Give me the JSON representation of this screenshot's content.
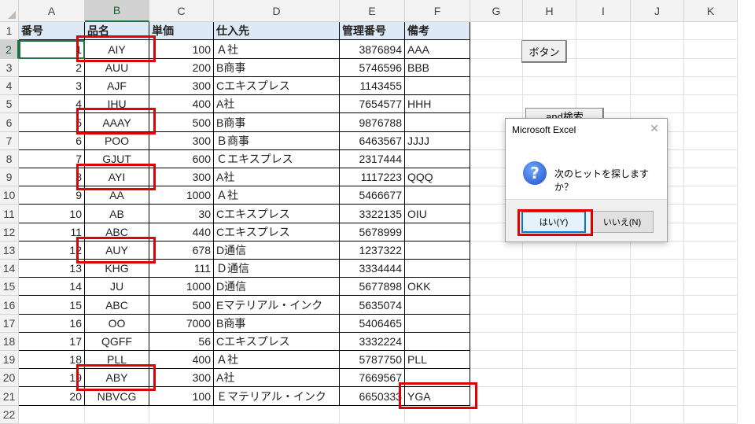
{
  "columns": [
    "A",
    "B",
    "C",
    "D",
    "E",
    "F",
    "G",
    "H",
    "I",
    "J",
    "K"
  ],
  "selected_column": "B",
  "rows": [
    "1",
    "2",
    "3",
    "4",
    "5",
    "6",
    "7",
    "8",
    "9",
    "10",
    "11",
    "12",
    "13",
    "14",
    "15",
    "16",
    "17",
    "18",
    "19",
    "20",
    "21",
    "22"
  ],
  "selected_row": "2",
  "table": {
    "headers": [
      "番号",
      "品名",
      "単価",
      "仕入先",
      "管理番号",
      "備考"
    ],
    "records": [
      [
        "1",
        "AIY",
        "100",
        "Ａ社",
        "3876894",
        "AAA"
      ],
      [
        "2",
        "AUU",
        "200",
        "B商事",
        "5746596",
        "BBB"
      ],
      [
        "3",
        "AJF",
        "300",
        "Cエキスプレス",
        "1143455",
        ""
      ],
      [
        "4",
        "IHU",
        "400",
        "A社",
        "7654577",
        "HHH"
      ],
      [
        "5",
        "AAAY",
        "500",
        "B商事",
        "9876788",
        ""
      ],
      [
        "6",
        "POO",
        "300",
        "Ｂ商事",
        "6463567",
        "JJJJ"
      ],
      [
        "7",
        "GJUT",
        "600",
        "Ｃエキスプレス",
        "2317444",
        ""
      ],
      [
        "8",
        "AYI",
        "300",
        "A社",
        "1117223",
        "QQQ"
      ],
      [
        "9",
        "AA",
        "1000",
        "Ａ社",
        "5466677",
        ""
      ],
      [
        "10",
        "AB",
        "30",
        "Cエキスプレス",
        "3322135",
        "OIU"
      ],
      [
        "11",
        "ABC",
        "440",
        "Cエキスプレス",
        "5678999",
        ""
      ],
      [
        "12",
        "AUY",
        "678",
        "D通信",
        "1237322",
        ""
      ],
      [
        "13",
        "KHG",
        "111",
        "Ｄ通信",
        "3334444",
        ""
      ],
      [
        "14",
        "JU",
        "1000",
        "D通信",
        "5677898",
        "OKK"
      ],
      [
        "15",
        "ABC",
        "500",
        "Eマテリアル・インク",
        "5635074",
        ""
      ],
      [
        "16",
        "OO",
        "7000",
        "B商事",
        "5406465",
        ""
      ],
      [
        "17",
        "QGFF",
        "56",
        "Cエキスプレス",
        "3332224",
        ""
      ],
      [
        "18",
        "PLL",
        "400",
        "Ａ社",
        "5787750",
        "PLL"
      ],
      [
        "19",
        "ABY",
        "300",
        "A社",
        "7669567",
        ""
      ],
      [
        "20",
        "NBVCG",
        "100",
        "Ｅマテリアル・インク",
        "6650333",
        "YGA"
      ]
    ]
  },
  "sheet_buttons": {
    "button1": "ボタン",
    "button2": "and検索"
  },
  "dialog": {
    "title": "Microsoft Excel",
    "close_glyph": "✕",
    "icon_glyph": "?",
    "message": "次のヒットを探しますか？",
    "yes_label": "はい(Y)",
    "no_label": "いいえ(N)"
  },
  "colors": {
    "highlight_red": "#e00000",
    "header_fill": "#dde9f5",
    "excel_green": "#217346"
  }
}
